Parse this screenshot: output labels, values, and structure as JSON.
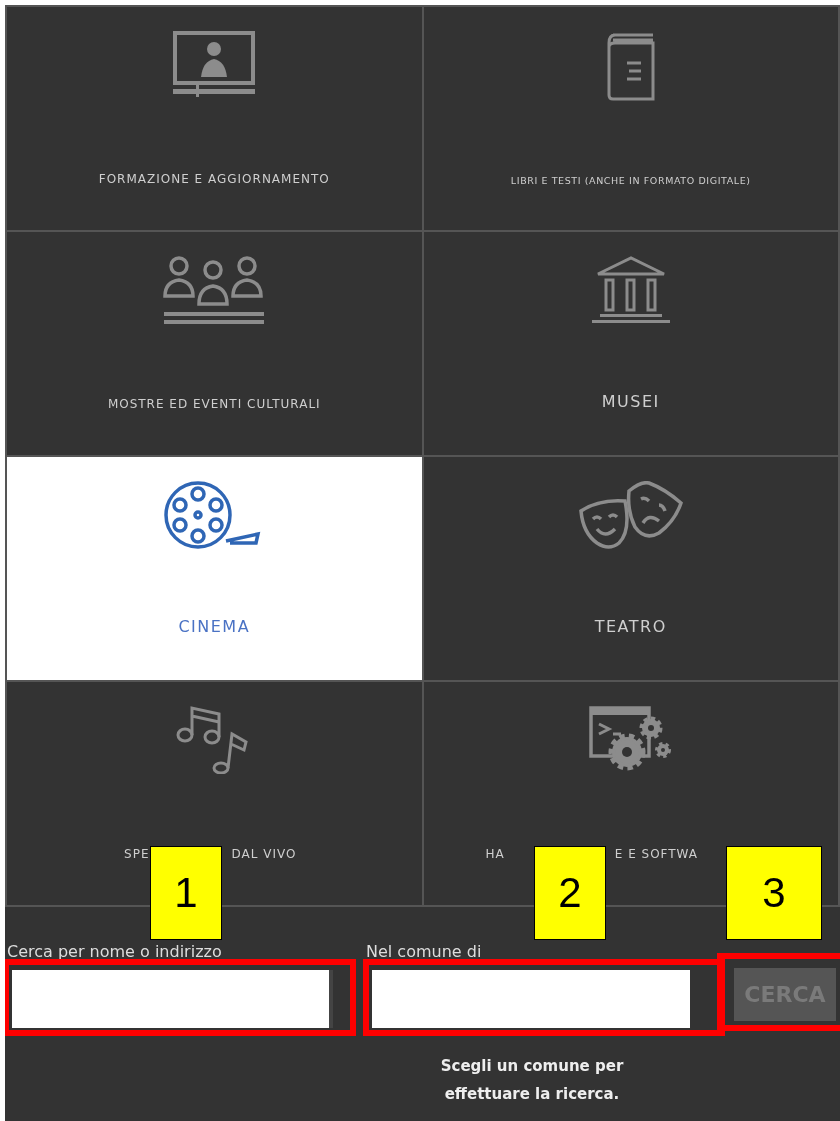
{
  "tiles": [
    {
      "label": "FORMAZIONE E AGGIORNAMENTO",
      "selected": false
    },
    {
      "label": "LIBRI E TESTI (ANCHE IN FORMATO DIGITALE)",
      "selected": false
    },
    {
      "label": "MOSTRE ED EVENTI CULTURALI",
      "selected": false
    },
    {
      "label": "MUSEI",
      "selected": false
    },
    {
      "label": "CINEMA",
      "selected": true
    },
    {
      "label": "TEATRO",
      "selected": false
    },
    {
      "label_parts": [
        "SPE",
        "DAL VIVO"
      ],
      "selected": false
    },
    {
      "label_parts": [
        "HA",
        "E E SOFTWA"
      ],
      "selected": false
    }
  ],
  "search": {
    "name_label": "Cerca per nome o indirizzo",
    "town_label": "Nel comune di",
    "button": "CERCA",
    "button_disabled": true,
    "hint": "Scegli un comune per effettuare la ricerca."
  },
  "annotations": [
    {
      "number": "1"
    },
    {
      "number": "2"
    },
    {
      "number": "3"
    }
  ]
}
